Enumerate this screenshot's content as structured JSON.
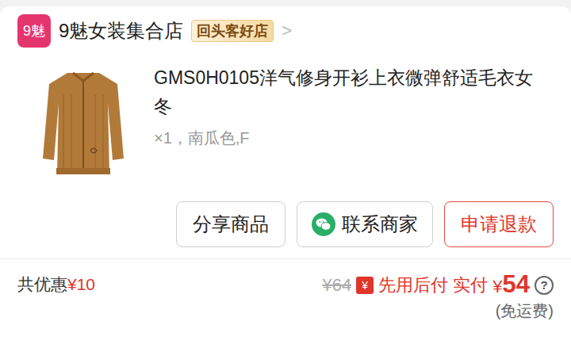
{
  "shop": {
    "logo": "9魅",
    "name": "9魅女装集合店",
    "badge": "回头客好店",
    "chevron": ">"
  },
  "product": {
    "title": "GMS0H0105洋气修身开衫上衣微弹舒适毛衣女冬",
    "spec": "×1，南瓜色,F"
  },
  "buttons": [
    {
      "label": "分享商品",
      "kind": "plain"
    },
    {
      "label": "联系商家",
      "kind": "wechat"
    },
    {
      "label": "申请退款",
      "kind": "danger"
    }
  ],
  "summary": {
    "discount_label": "共优惠",
    "discount": "¥10",
    "original_price": "¥64",
    "pay_icon": "¥",
    "pay_label": "先用后付 实付",
    "price_symbol": "¥",
    "price": "54",
    "help": "?",
    "shipping": "(免运费)"
  }
}
